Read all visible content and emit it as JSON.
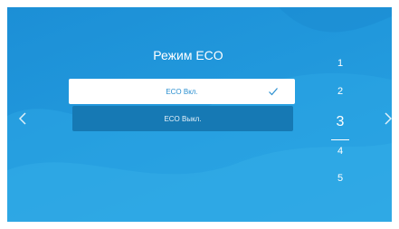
{
  "screen": {
    "title": "Режим ECO",
    "options": [
      {
        "label": "ECO Вкл.",
        "selected": true
      },
      {
        "label": "ECO Выкл.",
        "selected": false
      }
    ],
    "pages": [
      "1",
      "2",
      "3",
      "4",
      "5"
    ],
    "current_page": "3"
  },
  "colors": {
    "background": "#2198dc",
    "selected_bg": "#ffffff",
    "selected_text": "#2a8fd0",
    "option_bg": "#1679b4"
  },
  "icons": {
    "check": "check-icon",
    "left": "chevron-left-icon",
    "right": "chevron-right-icon"
  }
}
